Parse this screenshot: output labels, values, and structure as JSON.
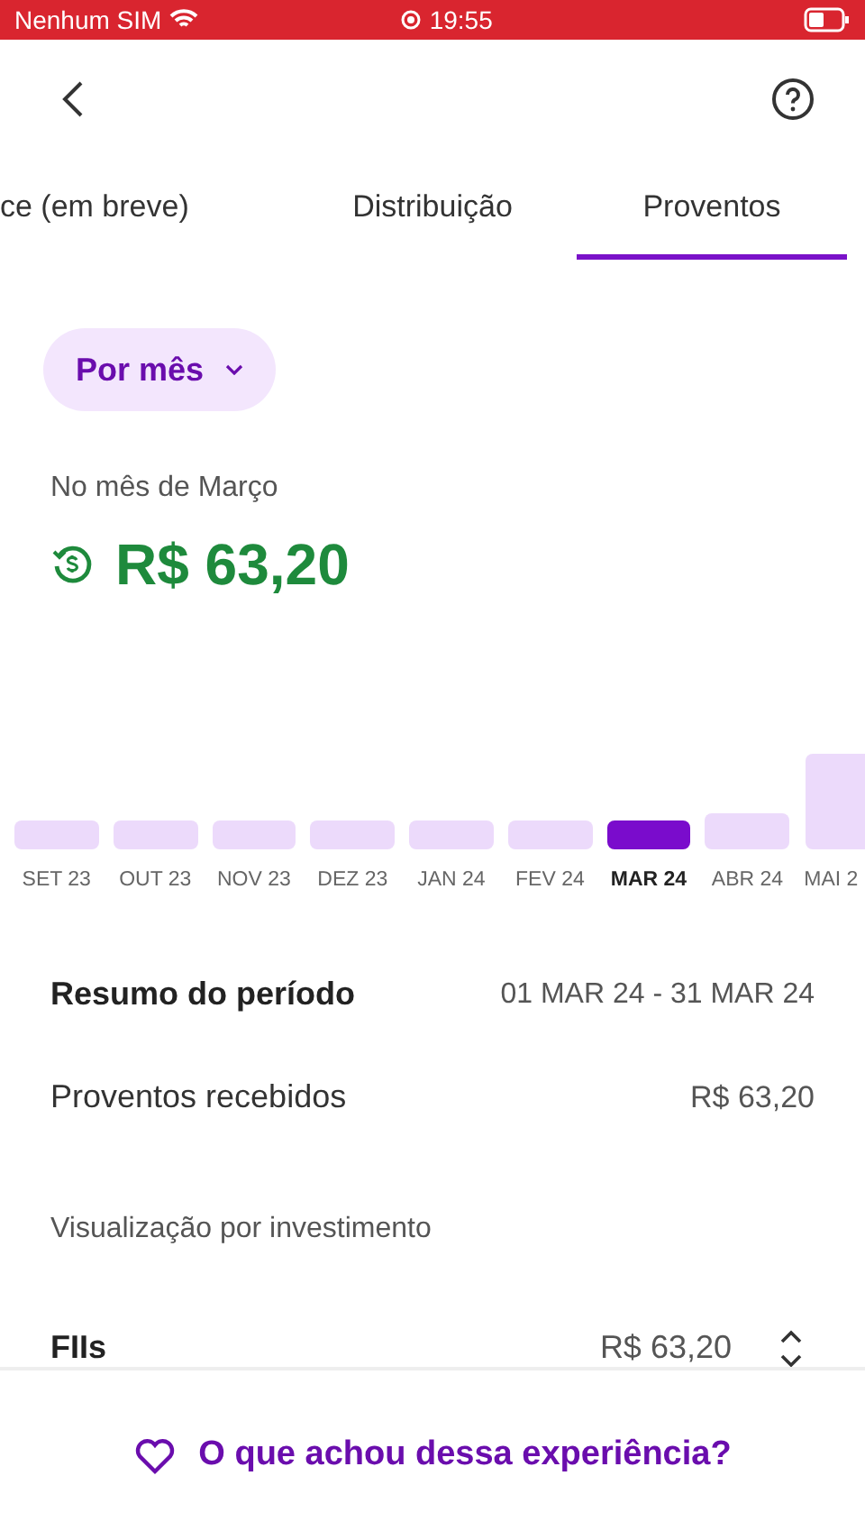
{
  "status_bar": {
    "carrier": "Nenhum SIM",
    "time": "19:55"
  },
  "tabs": [
    {
      "label": "ce (em breve)",
      "selected": false
    },
    {
      "label": "Distribuição",
      "selected": false
    },
    {
      "label": "Proventos",
      "selected": true
    }
  ],
  "period_selector": {
    "label": "Por mês"
  },
  "summary": {
    "caption": "No mês de Março",
    "amount": "R$ 63,20"
  },
  "months": [
    {
      "label": "SET 23",
      "selected": false
    },
    {
      "label": "OUT 23",
      "selected": false
    },
    {
      "label": "NOV 23",
      "selected": false
    },
    {
      "label": "DEZ 23",
      "selected": false
    },
    {
      "label": "JAN 24",
      "selected": false
    },
    {
      "label": "FEV 24",
      "selected": false
    },
    {
      "label": "MAR 24",
      "selected": true
    },
    {
      "label": "ABR 24",
      "selected": false
    },
    {
      "label": "MAI 2",
      "selected": false
    }
  ],
  "period_summary": {
    "title": "Resumo do período",
    "range": "01 MAR 24 - 31 MAR 24"
  },
  "received": {
    "label": "Proventos recebidos",
    "value": "R$ 63,20"
  },
  "breakdown": {
    "title": "Visualização por investimento",
    "rows": [
      {
        "label": "FIIs",
        "value": "R$ 63,20"
      }
    ]
  },
  "feedback": {
    "label": "O que achou dessa experiência?"
  }
}
